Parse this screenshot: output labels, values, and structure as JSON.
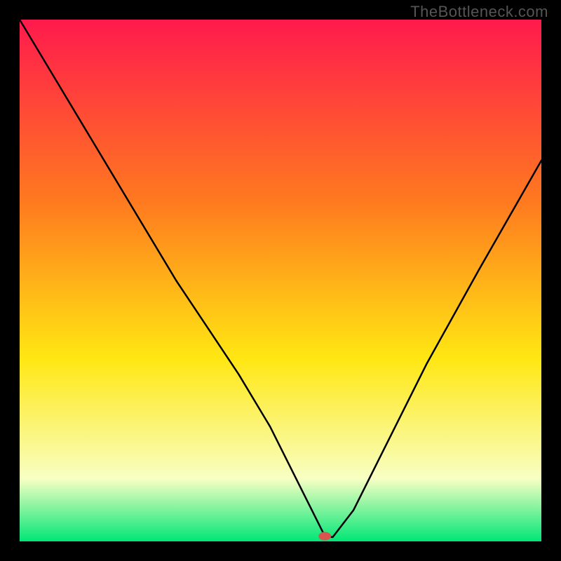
{
  "watermark": "TheBottleneck.com",
  "chart_data": {
    "type": "line",
    "title": "",
    "xlabel": "",
    "ylabel": "",
    "xlim": [
      0,
      100
    ],
    "ylim": [
      0,
      100
    ],
    "background_gradient": {
      "top": "#ff1a4d",
      "mid1": "#ff7a1f",
      "mid2": "#ffe713",
      "low": "#f8ffc3",
      "bottom": "#00e676"
    },
    "series": [
      {
        "name": "bottleneck-curve",
        "x": [
          0,
          6,
          12,
          18,
          24,
          30,
          36,
          42,
          48,
          52,
          55,
          57,
          58.5,
          60,
          64,
          70,
          78,
          88,
          100
        ],
        "values": [
          100,
          90,
          80,
          70,
          60,
          50,
          41,
          32,
          22,
          14,
          8,
          4,
          1,
          0.8,
          6,
          18,
          34,
          52,
          73
        ]
      }
    ],
    "marker": {
      "x": 58.5,
      "y": 1,
      "color": "#d9534f"
    }
  }
}
